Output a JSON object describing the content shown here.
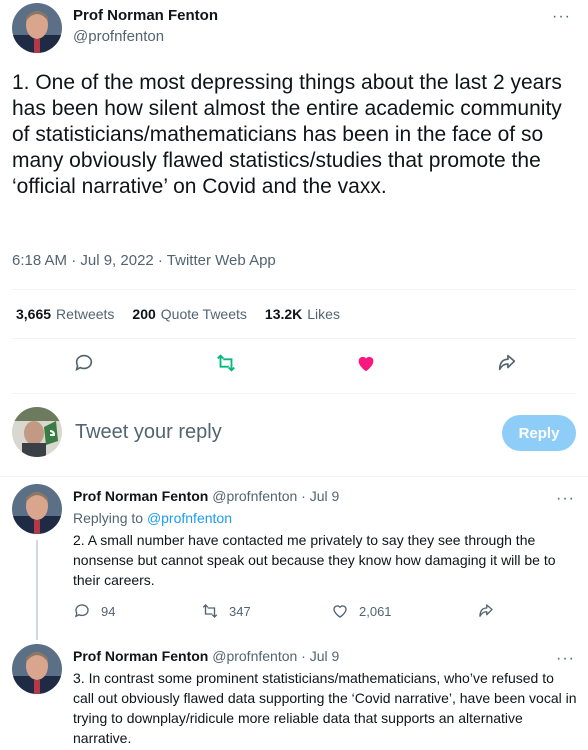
{
  "colors": {
    "text": "#0f1419",
    "secondary": "#536471",
    "link": "#1d9bf0",
    "retweet_green": "#00ba7c",
    "like_pink": "#f91880",
    "reply_button_bg": "#8ecdf8"
  },
  "main_tweet": {
    "author_name": "Prof Norman Fenton",
    "author_handle": "@profnfenton",
    "text": "1. One of the most depressing things about the last 2 years has been how silent almost the entire academic community of statisticians/mathematicians has been in the face of so many obviously flawed statistics/studies that promote the ‘official narrative’ on Covid and the vaxx.",
    "meta": "6:18 AM · Jul 9, 2022 · Twitter Web App",
    "stats": {
      "retweets_count": "3,665",
      "retweets_label": "Retweets",
      "quotes_count": "200",
      "quotes_label": "Quote Tweets",
      "likes_count": "13.2K",
      "likes_label": "Likes"
    },
    "icons": [
      "reply-icon",
      "retweet-icon",
      "like-icon",
      "share-icon"
    ]
  },
  "reply_composer": {
    "placeholder": "Tweet your reply",
    "button_label": "Reply"
  },
  "replies": [
    {
      "author_name": "Prof Norman Fenton",
      "author_handle": "@profnfenton",
      "date": "Jul 9",
      "replying_label": "Replying to",
      "replying_to": "@profnfenton",
      "text": "2. A small number have contacted me privately to say they see through the nonsense but cannot speak out because they know how damaging it will be to their careers.",
      "reply_count": "94",
      "retweet_count": "347",
      "like_count": "2,061"
    },
    {
      "author_name": "Prof Norman Fenton",
      "author_handle": "@profnfenton",
      "date": "Jul 9",
      "text": "3. In contrast some prominent statisticians/mathematicians, who’ve refused to call out obviously flawed data supporting the ‘Covid narrative’, have been vocal in trying to downplay/ridicule more reliable data that supports an alternative narrative."
    }
  ]
}
